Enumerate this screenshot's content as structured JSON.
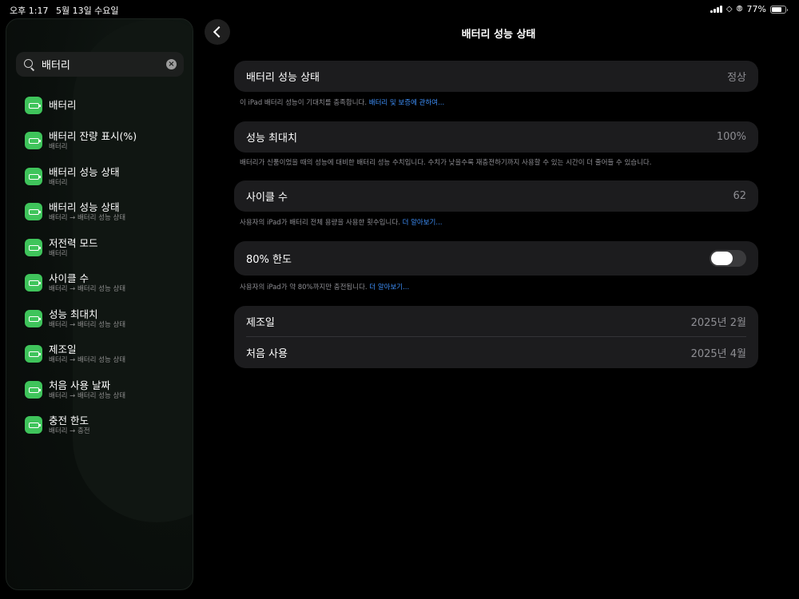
{
  "status_bar": {
    "time": "오후 1:17",
    "date": "5월 13일 수요일",
    "battery_percent": "77%"
  },
  "search": {
    "value": "배터리"
  },
  "results": [
    {
      "title": "배터리",
      "subtitle": ""
    },
    {
      "title": "배터리 잔량 표시(%)",
      "subtitle": "배터리"
    },
    {
      "title": "배터리 성능 상태",
      "subtitle": "배터리"
    },
    {
      "title": "배터리 성능 상태",
      "subtitle": "배터리 → 배터리 성능 상태"
    },
    {
      "title": "저전력 모드",
      "subtitle": "배터리"
    },
    {
      "title": "사이클 수",
      "subtitle": "배터리 → 배터리 성능 상태"
    },
    {
      "title": "성능 최대치",
      "subtitle": "배터리 → 배터리 성능 상태"
    },
    {
      "title": "제조일",
      "subtitle": "배터리 → 배터리 성능 상태"
    },
    {
      "title": "처음 사용 날짜",
      "subtitle": "배터리 → 배터리 성능 상태"
    },
    {
      "title": "충전 한도",
      "subtitle": "배터리 → 충전"
    }
  ],
  "main": {
    "title": "배터리 성능 상태",
    "health": {
      "label": "배터리 성능 상태",
      "value": "정상",
      "note": "이 iPad 배터리 성능이 기대치를 충족합니다. ",
      "link": "배터리 및 보증에 관하여..."
    },
    "max_capacity": {
      "label": "성능 최대치",
      "value": "100%",
      "note": "배터리가 신품이었을 때의 성능에 대비한 배터리 성능 수치입니다. 수치가 낮을수록 재충전하기까지 사용할 수 있는 시간이 더 줄어들 수 있습니다."
    },
    "cycle_count": {
      "label": "사이클 수",
      "value": "62",
      "note": "사용자의 iPad가 배터리 전체 용량을 사용한 횟수입니다. ",
      "link": "더 알아보기..."
    },
    "limit": {
      "label": "80% 한도",
      "enabled": false,
      "note": "사용자의 iPad가 약 80%까지만 충전됩니다. ",
      "link": "더 알아보기..."
    },
    "dates": {
      "manufacture_label": "제조일",
      "manufacture_value": "2025년 2월",
      "first_use_label": "처음 사용",
      "first_use_value": "2025년 4월"
    }
  },
  "colors": {
    "accent_green": "#3fc45b",
    "link_blue": "#3d8ef7",
    "card_bg": "#1c1c1e"
  }
}
